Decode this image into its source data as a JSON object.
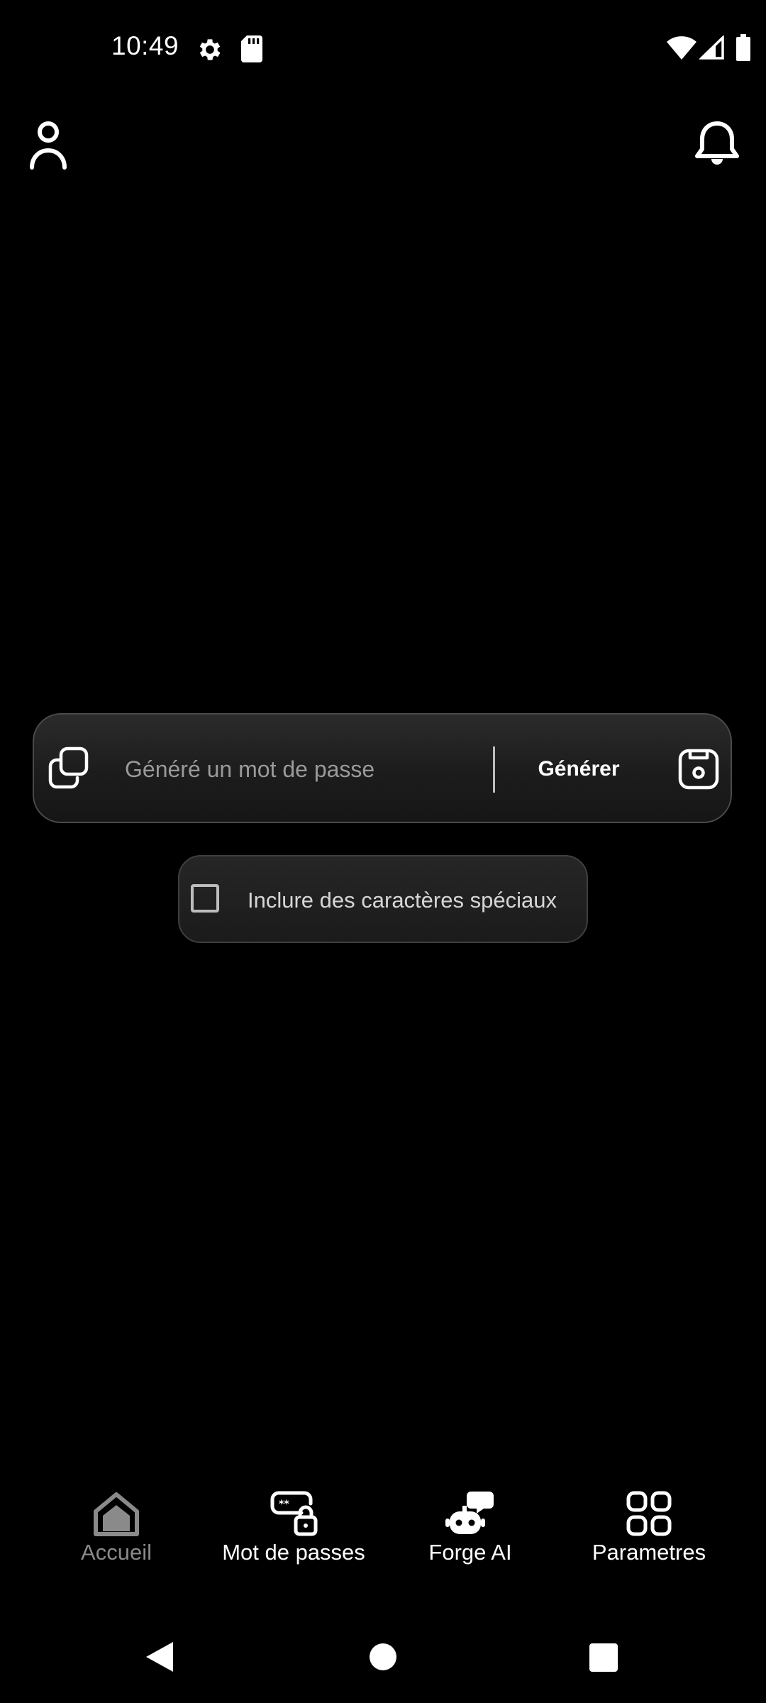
{
  "status_bar": {
    "time": "10:49",
    "icons": [
      "gear-icon",
      "sd-card-icon",
      "wifi-icon",
      "signal-icon",
      "battery-icon"
    ]
  },
  "top_bar": {
    "left_icon": "profile-icon",
    "right_icon": "bell-icon"
  },
  "generator": {
    "copy_icon": "copy-icon",
    "placeholder": "Généré un mot de passe",
    "value": "",
    "generate_label": "Générer",
    "save_icon": "save-icon"
  },
  "options": {
    "special_chars_label": "Inclure des caractères spéciaux",
    "special_chars_checked": false
  },
  "bottom_nav": {
    "items": [
      {
        "label": "Accueil",
        "icon": "home-icon",
        "active": false
      },
      {
        "label": "Mot de passes",
        "icon": "password-lock-icon",
        "active": true
      },
      {
        "label": "Forge AI",
        "icon": "robot-chat-icon",
        "active": true
      },
      {
        "label": "Parametres",
        "icon": "grid-icon",
        "active": true
      }
    ]
  },
  "system_nav": {
    "icons": [
      "back-icon",
      "home-circle-icon",
      "recents-icon"
    ]
  },
  "colors": {
    "background": "#000000",
    "text": "#ffffff",
    "muted": "#8a8a8a",
    "card_border": "#4a4a4a"
  }
}
